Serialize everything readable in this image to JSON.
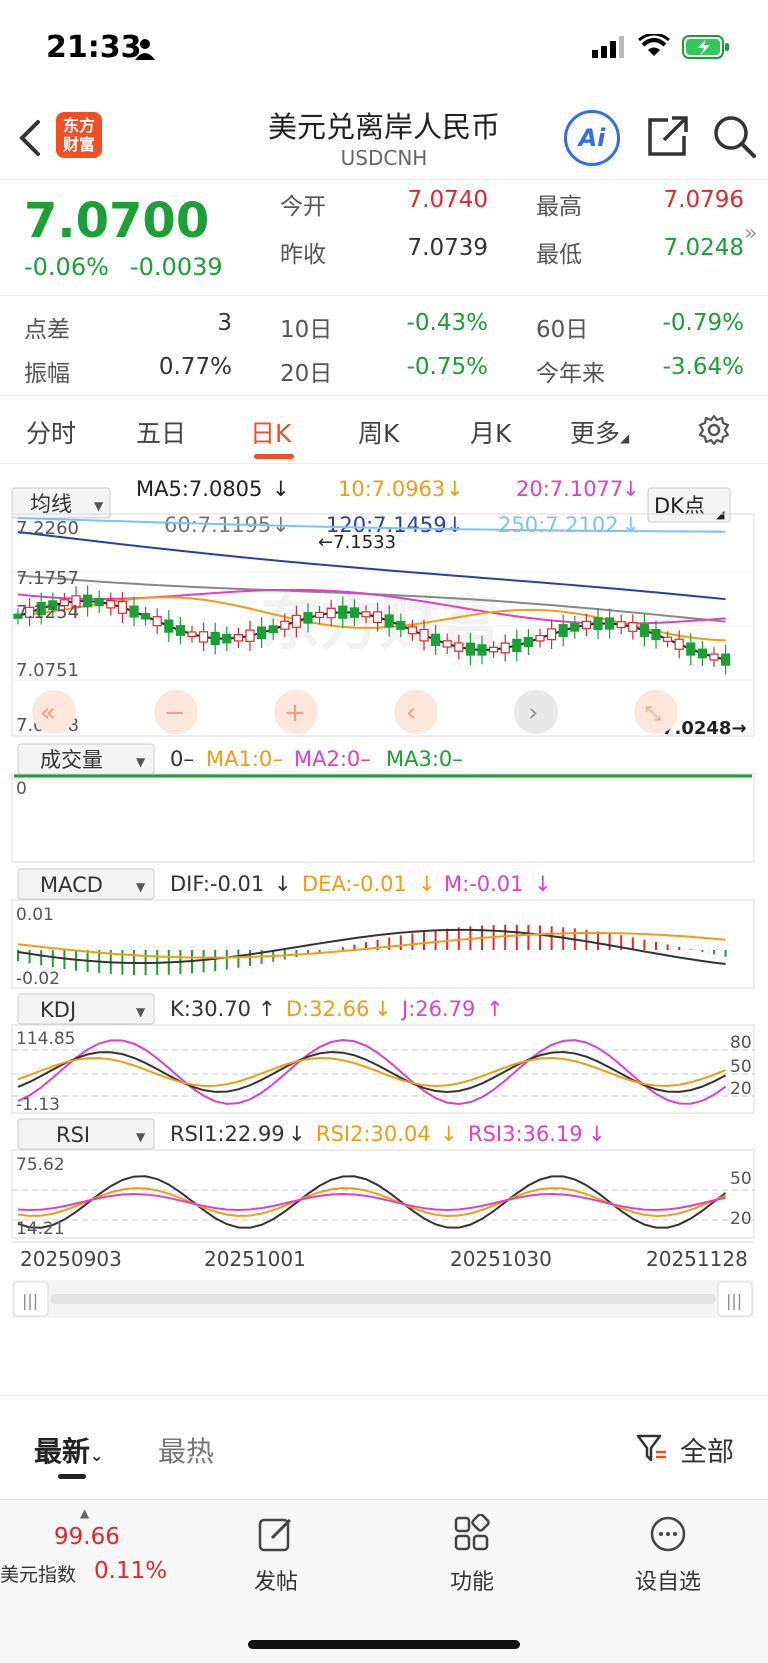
{
  "status": {
    "time": "21:33"
  },
  "nav": {
    "logo": "东方\n财富",
    "logo_top": "东方",
    "logo_bottom": "财富",
    "title": "美元兑离岸人民币",
    "subtitle": "USDCNH",
    "ai_label": "Ai"
  },
  "quote": {
    "price": "7.0700",
    "change_pct": "-0.06%",
    "change_val": "-0.0039",
    "open_label": "今开",
    "open": "7.0740",
    "high_label": "最高",
    "high": "7.0796",
    "prev_label": "昨收",
    "prev": "7.0739",
    "low_label": "最低",
    "low": "7.0248"
  },
  "stats": {
    "spread_label": "点差",
    "spread": "3",
    "d10_label": "10日",
    "d10": "-0.43%",
    "d60_label": "60日",
    "d60": "-0.79%",
    "amp_label": "振幅",
    "amp": "0.77%",
    "d20_label": "20日",
    "d20": "-0.75%",
    "ytd_label": "今年来",
    "ytd": "-3.64%"
  },
  "tabs": [
    "分时",
    "五日",
    "日K",
    "周K",
    "月K",
    "更多"
  ],
  "chart": {
    "ma_select": "均线",
    "ma5": "MA5:7.0805",
    "ma10": "10:7.0963",
    "ma20": "20:7.1077",
    "ma60": "60:7.1195",
    "ma120": "120:7.1459",
    "ma250": "250:7.2102",
    "dk_label": "DK点",
    "y_top": "7.2260",
    "y_2": "7.1757",
    "y_3": "7.1254",
    "y_4": "7.0751",
    "y_bottom": "7.0248",
    "peak_label": "7.1533",
    "low_label": "7.0248",
    "vol_select": "成交量",
    "vol_val": "0–",
    "vol_ma1": "MA1:0–",
    "vol_ma2": "MA2:0–",
    "vol_ma3": "MA3:0–",
    "vol_axis": "0",
    "macd_select": "MACD",
    "macd_dif": "DIF:-0.01",
    "macd_dea": "DEA:-0.01",
    "macd_m": "M:-0.01",
    "macd_top": "0.01",
    "macd_bottom": "-0.02",
    "kdj_select": "KDJ",
    "kdj_k": "K:30.70",
    "kdj_d": "D:32.66",
    "kdj_j": "J:26.79",
    "kdj_top": "114.85",
    "kdj_bottom": "-1.13",
    "kdj_80": "80",
    "kdj_50": "50",
    "kdj_20": "20",
    "rsi_select": "RSI",
    "rsi1": "RSI1:22.99",
    "rsi2": "RSI2:30.04",
    "rsi3": "RSI3:36.19",
    "rsi_top": "75.62",
    "rsi_bottom": "14.21",
    "rsi_50": "50",
    "rsi_20": "20",
    "dates": [
      "20250903",
      "20251001",
      "20251030",
      "20251128"
    ]
  },
  "bottom_tabs": {
    "latest": "最新",
    "hot": "最热",
    "all": "全部"
  },
  "toolbar": {
    "index_val": "99.66",
    "index_label": "美元指数",
    "index_pct": "0.11%",
    "post": "发帖",
    "func": "功能",
    "watch": "设自选"
  },
  "colors": {
    "up": "#e5262b",
    "down": "#1aa035",
    "accent": "#f25022",
    "ma10": "#f39c12",
    "ma20": "#e040c8",
    "ma120": "#2c3db0",
    "ma250": "#7cc4f0"
  }
}
